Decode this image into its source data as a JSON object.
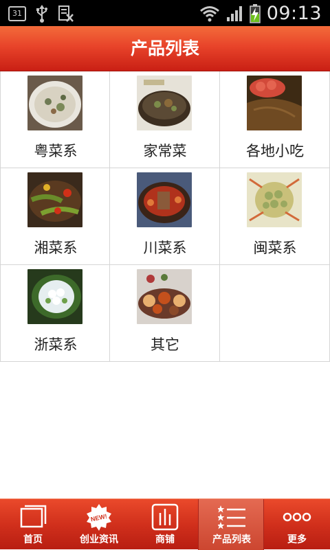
{
  "status_bar": {
    "calendar_day": "31",
    "time": "09:13",
    "icons": [
      "calendar-icon",
      "usb-icon",
      "keyboard-icon",
      "wifi-icon",
      "signal-icon",
      "battery-charging-icon"
    ]
  },
  "header": {
    "title": "产品列表"
  },
  "grid": {
    "items": [
      {
        "label": "粤菜系",
        "thumb_colors": [
          "#d9d2c2",
          "#e8e4da",
          "#6f7b55",
          "#8a6a48"
        ]
      },
      {
        "label": "家常菜",
        "thumb_colors": [
          "#5b4a35",
          "#d9d0b5",
          "#7c8c4a",
          "#3c2e20"
        ]
      },
      {
        "label": "各地小吃",
        "thumb_colors": [
          "#6f4a22",
          "#d24a3a",
          "#e46450",
          "#3d2a14"
        ]
      },
      {
        "label": "湘菜系",
        "thumb_colors": [
          "#6a8c2a",
          "#d23018",
          "#e0b028",
          "#3a2a1c"
        ]
      },
      {
        "label": "川菜系",
        "thumb_colors": [
          "#3a2418",
          "#b0321c",
          "#e07a3a",
          "#4a5a7a"
        ]
      },
      {
        "label": "闽菜系",
        "thumb_colors": [
          "#e8e4c8",
          "#9aa860",
          "#c9c07a",
          "#d26a3a"
        ]
      },
      {
        "label": "浙菜系",
        "thumb_colors": [
          "#263a1c",
          "#3d6a2a",
          "#e6eef0",
          "#6ea04a"
        ]
      },
      {
        "label": "其它",
        "thumb_colors": [
          "#d8d2cc",
          "#c4501c",
          "#e8b070",
          "#6a3a2a"
        ]
      }
    ]
  },
  "bottom_nav": {
    "items": [
      {
        "label": "首页",
        "icon": "home-pages-icon",
        "active": false
      },
      {
        "label": "创业资讯",
        "icon": "new-badge-icon",
        "badge_text": "NEW!",
        "active": false
      },
      {
        "label": "商铺",
        "icon": "shop-bars-icon",
        "active": false
      },
      {
        "label": "产品列表",
        "icon": "star-list-icon",
        "active": true
      },
      {
        "label": "更多",
        "icon": "more-dots-icon",
        "active": false
      }
    ]
  }
}
